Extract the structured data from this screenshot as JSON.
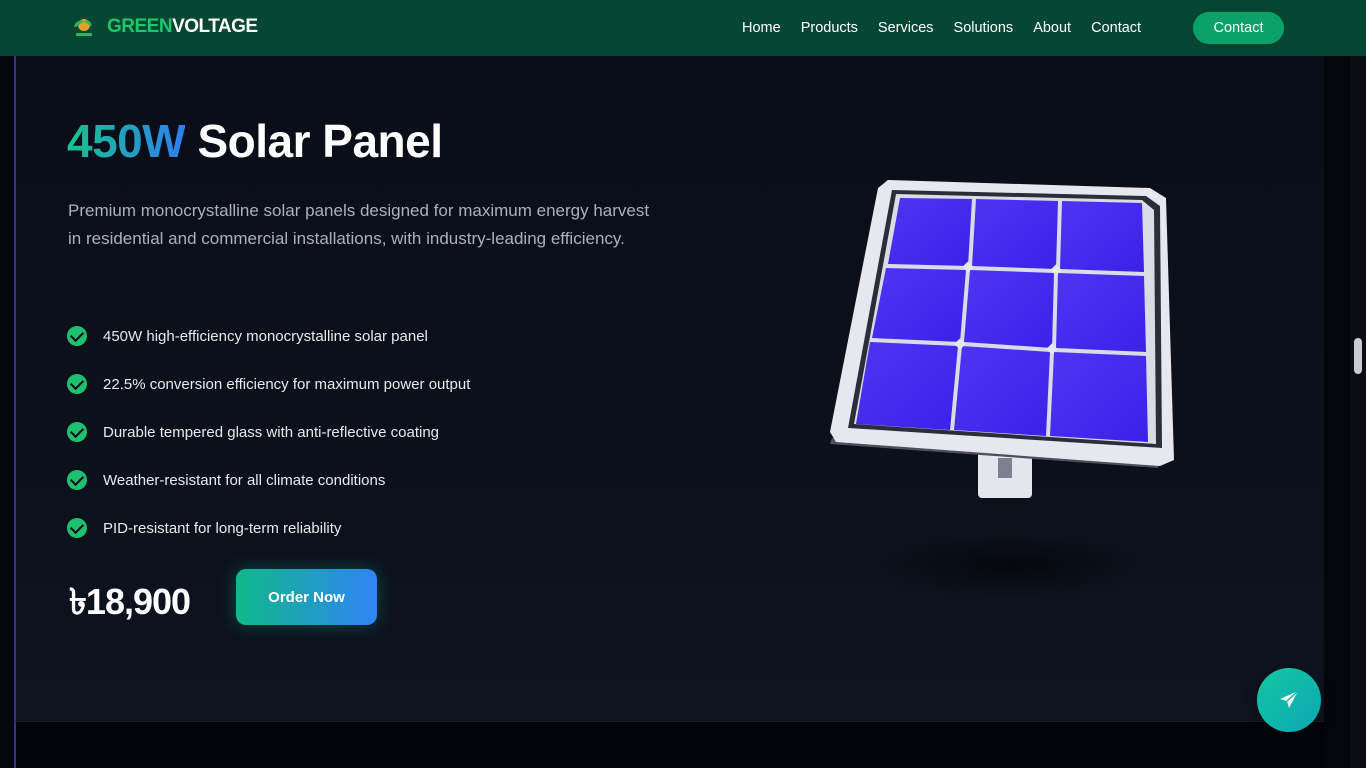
{
  "brand": {
    "part1": "GREEN",
    "part2": "VOLTAGE"
  },
  "nav": {
    "links": [
      "Home",
      "Products",
      "Services",
      "Solutions",
      "About",
      "Contact"
    ],
    "cta": "Contact"
  },
  "hero": {
    "title_accent": "450W",
    "title_rest": "Solar Panel",
    "description": "Premium monocrystalline solar panels designed for maximum energy harvest in residential and commercial installations, with industry-leading efficiency.",
    "features": [
      "450W high-efficiency monocrystalline solar panel",
      "22.5% conversion efficiency for maximum power output",
      "Durable tempered glass with anti-reflective coating",
      "Weather-resistant for all climate conditions",
      "PID-resistant for long-term reliability"
    ],
    "price": "৳18,900",
    "order_label": "Order Now"
  },
  "icons": {
    "logo": "leaf-sun-logo-icon",
    "check": "check-circle-icon",
    "fab": "send-paper-plane-icon"
  },
  "colors": {
    "nav_bg": "#054733",
    "accent_green": "#1fbf6e",
    "accent_blue": "#2f84f5",
    "cell_blue": "#4a2cf0"
  }
}
